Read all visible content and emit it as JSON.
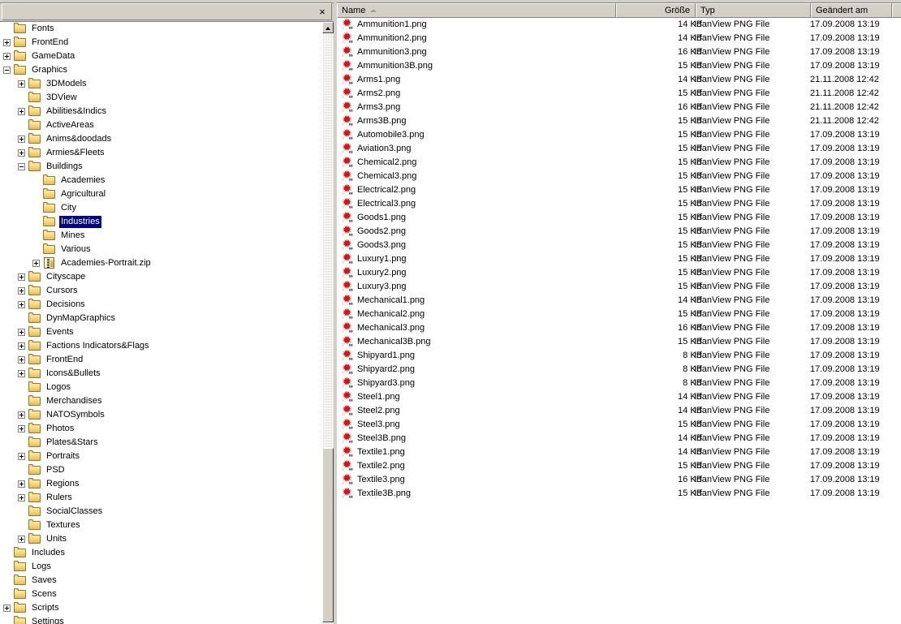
{
  "window": {
    "close_label": "×"
  },
  "tree": {
    "scrollbar": {
      "up_arrow": "scroll-up"
    },
    "items": [
      {
        "label": "Fonts",
        "indent": 1,
        "toggle": "none",
        "icon": "folder",
        "selected": false
      },
      {
        "label": "FrontEnd",
        "indent": 1,
        "toggle": "expand",
        "icon": "folder",
        "selected": false
      },
      {
        "label": "GameData",
        "indent": 1,
        "toggle": "expand",
        "icon": "folder",
        "selected": false
      },
      {
        "label": "Graphics",
        "indent": 1,
        "toggle": "collapse",
        "icon": "folder",
        "selected": false
      },
      {
        "label": "3DModels",
        "indent": 2,
        "toggle": "expand",
        "icon": "folder",
        "selected": false
      },
      {
        "label": "3DView",
        "indent": 2,
        "toggle": "none",
        "icon": "folder",
        "selected": false
      },
      {
        "label": "Abilities&Indics",
        "indent": 2,
        "toggle": "expand",
        "icon": "folder",
        "selected": false
      },
      {
        "label": "ActiveAreas",
        "indent": 2,
        "toggle": "none",
        "icon": "folder",
        "selected": false
      },
      {
        "label": "Anims&doodads",
        "indent": 2,
        "toggle": "expand",
        "icon": "folder",
        "selected": false
      },
      {
        "label": "Armies&Fleets",
        "indent": 2,
        "toggle": "expand",
        "icon": "folder",
        "selected": false
      },
      {
        "label": "Buildings",
        "indent": 2,
        "toggle": "collapse",
        "icon": "folder",
        "selected": false
      },
      {
        "label": "Academies",
        "indent": 3,
        "toggle": "none",
        "icon": "folder",
        "selected": false
      },
      {
        "label": "Agricultural",
        "indent": 3,
        "toggle": "none",
        "icon": "folder",
        "selected": false
      },
      {
        "label": "City",
        "indent": 3,
        "toggle": "none",
        "icon": "folder",
        "selected": false
      },
      {
        "label": "Industries",
        "indent": 3,
        "toggle": "none",
        "icon": "folder",
        "selected": true
      },
      {
        "label": "Mines",
        "indent": 3,
        "toggle": "none",
        "icon": "folder",
        "selected": false
      },
      {
        "label": "Various",
        "indent": 3,
        "toggle": "none",
        "icon": "folder",
        "selected": false
      },
      {
        "label": "Academies-Portrait.zip",
        "indent": 3,
        "toggle": "expand",
        "icon": "zip",
        "selected": false
      },
      {
        "label": "Cityscape",
        "indent": 2,
        "toggle": "expand",
        "icon": "folder",
        "selected": false
      },
      {
        "label": "Cursors",
        "indent": 2,
        "toggle": "expand",
        "icon": "folder",
        "selected": false
      },
      {
        "label": "Decisions",
        "indent": 2,
        "toggle": "expand",
        "icon": "folder",
        "selected": false
      },
      {
        "label": "DynMapGraphics",
        "indent": 2,
        "toggle": "none",
        "icon": "folder",
        "selected": false
      },
      {
        "label": "Events",
        "indent": 2,
        "toggle": "expand",
        "icon": "folder",
        "selected": false
      },
      {
        "label": "Factions Indicators&Flags",
        "indent": 2,
        "toggle": "expand",
        "icon": "folder",
        "selected": false
      },
      {
        "label": "FrontEnd",
        "indent": 2,
        "toggle": "expand",
        "icon": "folder",
        "selected": false
      },
      {
        "label": "Icons&Bullets",
        "indent": 2,
        "toggle": "expand",
        "icon": "folder",
        "selected": false
      },
      {
        "label": "Logos",
        "indent": 2,
        "toggle": "none",
        "icon": "folder",
        "selected": false
      },
      {
        "label": "Merchandises",
        "indent": 2,
        "toggle": "none",
        "icon": "folder",
        "selected": false
      },
      {
        "label": "NATOSymbols",
        "indent": 2,
        "toggle": "expand",
        "icon": "folder",
        "selected": false
      },
      {
        "label": "Photos",
        "indent": 2,
        "toggle": "expand",
        "icon": "folder",
        "selected": false
      },
      {
        "label": "Plates&Stars",
        "indent": 2,
        "toggle": "none",
        "icon": "folder",
        "selected": false
      },
      {
        "label": "Portraits",
        "indent": 2,
        "toggle": "expand",
        "icon": "folder",
        "selected": false
      },
      {
        "label": "PSD",
        "indent": 2,
        "toggle": "none",
        "icon": "folder",
        "selected": false
      },
      {
        "label": "Regions",
        "indent": 2,
        "toggle": "expand",
        "icon": "folder",
        "selected": false
      },
      {
        "label": "Rulers",
        "indent": 2,
        "toggle": "expand",
        "icon": "folder",
        "selected": false
      },
      {
        "label": "SocialClasses",
        "indent": 2,
        "toggle": "none",
        "icon": "folder",
        "selected": false
      },
      {
        "label": "Textures",
        "indent": 2,
        "toggle": "none",
        "icon": "folder",
        "selected": false
      },
      {
        "label": "Units",
        "indent": 2,
        "toggle": "expand",
        "icon": "folder",
        "selected": false
      },
      {
        "label": "Includes",
        "indent": 1,
        "toggle": "none",
        "icon": "folder",
        "selected": false
      },
      {
        "label": "Logs",
        "indent": 1,
        "toggle": "none",
        "icon": "folder",
        "selected": false
      },
      {
        "label": "Saves",
        "indent": 1,
        "toggle": "none",
        "icon": "folder",
        "selected": false
      },
      {
        "label": "Scens",
        "indent": 1,
        "toggle": "none",
        "icon": "folder",
        "selected": false
      },
      {
        "label": "Scripts",
        "indent": 1,
        "toggle": "expand",
        "icon": "folder",
        "selected": false
      },
      {
        "label": "Settings",
        "indent": 1,
        "toggle": "none",
        "icon": "folder",
        "selected": false
      }
    ]
  },
  "filelist": {
    "columns": [
      {
        "key": "name",
        "label": "Name",
        "align": "left",
        "sorted": true
      },
      {
        "key": "size",
        "label": "Größe",
        "align": "right",
        "sorted": false
      },
      {
        "key": "type",
        "label": "Typ",
        "align": "left",
        "sorted": false
      },
      {
        "key": "date",
        "label": "Geändert am",
        "align": "left",
        "sorted": false
      }
    ],
    "rows": [
      {
        "name": "Ammunition1.png",
        "size": "14 KB",
        "type": "IrfanView PNG File",
        "date": "17.09.2008 13:19"
      },
      {
        "name": "Ammunition2.png",
        "size": "14 KB",
        "type": "IrfanView PNG File",
        "date": "17.09.2008 13:19"
      },
      {
        "name": "Ammunition3.png",
        "size": "16 KB",
        "type": "IrfanView PNG File",
        "date": "17.09.2008 13:19"
      },
      {
        "name": "Ammunition3B.png",
        "size": "15 KB",
        "type": "IrfanView PNG File",
        "date": "17.09.2008 13:19"
      },
      {
        "name": "Arms1.png",
        "size": "14 KB",
        "type": "IrfanView PNG File",
        "date": "21.11.2008 12:42"
      },
      {
        "name": "Arms2.png",
        "size": "15 KB",
        "type": "IrfanView PNG File",
        "date": "21.11.2008 12:42"
      },
      {
        "name": "Arms3.png",
        "size": "16 KB",
        "type": "IrfanView PNG File",
        "date": "21.11.2008 12:42"
      },
      {
        "name": "Arms3B.png",
        "size": "15 KB",
        "type": "IrfanView PNG File",
        "date": "21.11.2008 12:42"
      },
      {
        "name": "Automobile3.png",
        "size": "15 KB",
        "type": "IrfanView PNG File",
        "date": "17.09.2008 13:19"
      },
      {
        "name": "Aviation3.png",
        "size": "15 KB",
        "type": "IrfanView PNG File",
        "date": "17.09.2008 13:19"
      },
      {
        "name": "Chemical2.png",
        "size": "15 KB",
        "type": "IrfanView PNG File",
        "date": "17.09.2008 13:19"
      },
      {
        "name": "Chemical3.png",
        "size": "15 KB",
        "type": "IrfanView PNG File",
        "date": "17.09.2008 13:19"
      },
      {
        "name": "Electrical2.png",
        "size": "15 KB",
        "type": "IrfanView PNG File",
        "date": "17.09.2008 13:19"
      },
      {
        "name": "Electrical3.png",
        "size": "15 KB",
        "type": "IrfanView PNG File",
        "date": "17.09.2008 13:19"
      },
      {
        "name": "Goods1.png",
        "size": "15 KB",
        "type": "IrfanView PNG File",
        "date": "17.09.2008 13:19"
      },
      {
        "name": "Goods2.png",
        "size": "15 KB",
        "type": "IrfanView PNG File",
        "date": "17.09.2008 13:19"
      },
      {
        "name": "Goods3.png",
        "size": "15 KB",
        "type": "IrfanView PNG File",
        "date": "17.09.2008 13:19"
      },
      {
        "name": "Luxury1.png",
        "size": "15 KB",
        "type": "IrfanView PNG File",
        "date": "17.09.2008 13:19"
      },
      {
        "name": "Luxury2.png",
        "size": "15 KB",
        "type": "IrfanView PNG File",
        "date": "17.09.2008 13:19"
      },
      {
        "name": "Luxury3.png",
        "size": "15 KB",
        "type": "IrfanView PNG File",
        "date": "17.09.2008 13:19"
      },
      {
        "name": "Mechanical1.png",
        "size": "14 KB",
        "type": "IrfanView PNG File",
        "date": "17.09.2008 13:19"
      },
      {
        "name": "Mechanical2.png",
        "size": "15 KB",
        "type": "IrfanView PNG File",
        "date": "17.09.2008 13:19"
      },
      {
        "name": "Mechanical3.png",
        "size": "16 KB",
        "type": "IrfanView PNG File",
        "date": "17.09.2008 13:19"
      },
      {
        "name": "Mechanical3B.png",
        "size": "15 KB",
        "type": "IrfanView PNG File",
        "date": "17.09.2008 13:19"
      },
      {
        "name": "Shipyard1.png",
        "size": "8 KB",
        "type": "IrfanView PNG File",
        "date": "17.09.2008 13:19"
      },
      {
        "name": "Shipyard2.png",
        "size": "8 KB",
        "type": "IrfanView PNG File",
        "date": "17.09.2008 13:19"
      },
      {
        "name": "Shipyard3.png",
        "size": "8 KB",
        "type": "IrfanView PNG File",
        "date": "17.09.2008 13:19"
      },
      {
        "name": "Steel1.png",
        "size": "14 KB",
        "type": "IrfanView PNG File",
        "date": "17.09.2008 13:19"
      },
      {
        "name": "Steel2.png",
        "size": "14 KB",
        "type": "IrfanView PNG File",
        "date": "17.09.2008 13:19"
      },
      {
        "name": "Steel3.png",
        "size": "15 KB",
        "type": "IrfanView PNG File",
        "date": "17.09.2008 13:19"
      },
      {
        "name": "Steel3B.png",
        "size": "14 KB",
        "type": "IrfanView PNG File",
        "date": "17.09.2008 13:19"
      },
      {
        "name": "Textile1.png",
        "size": "14 KB",
        "type": "IrfanView PNG File",
        "date": "17.09.2008 13:19"
      },
      {
        "name": "Textile2.png",
        "size": "15 KB",
        "type": "IrfanView PNG File",
        "date": "17.09.2008 13:19"
      },
      {
        "name": "Textile3.png",
        "size": "16 KB",
        "type": "IrfanView PNG File",
        "date": "17.09.2008 13:19"
      },
      {
        "name": "Textile3B.png",
        "size": "15 KB",
        "type": "IrfanView PNG File",
        "date": "17.09.2008 13:19"
      }
    ]
  }
}
